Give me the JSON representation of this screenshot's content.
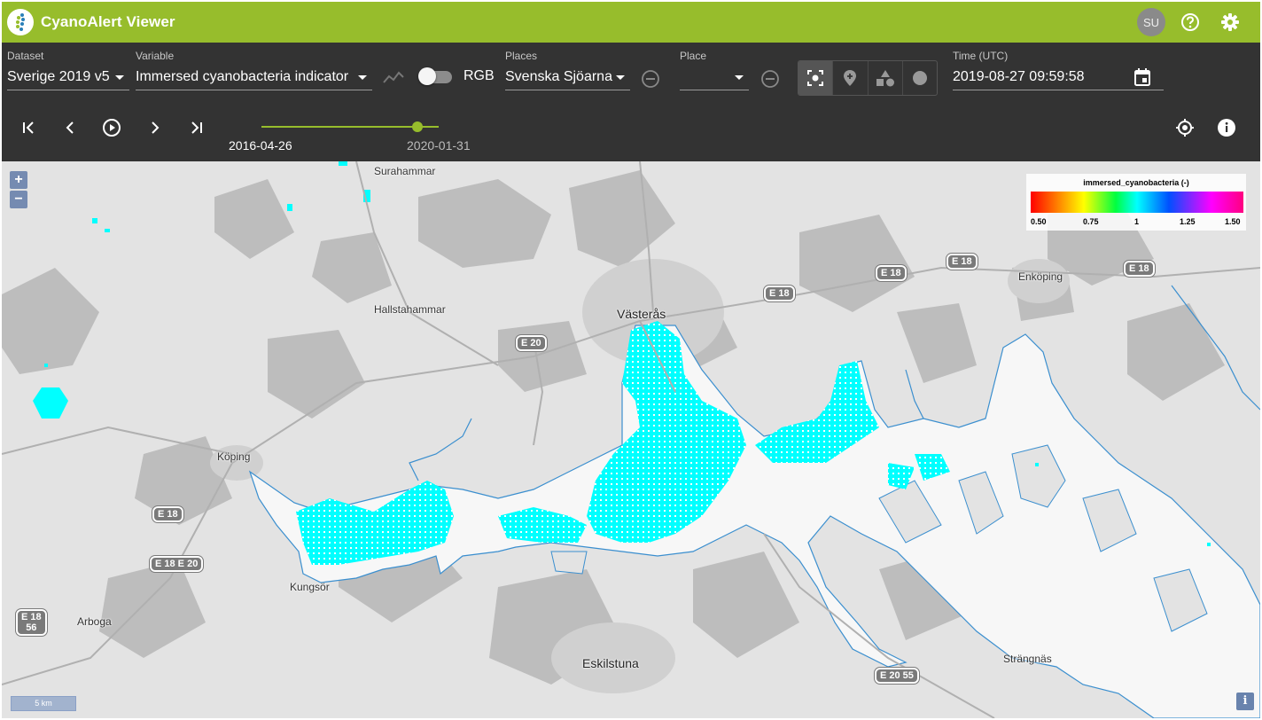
{
  "app": {
    "title": "CyanoAlert Viewer",
    "user_initials": "SU",
    "accent_color": "#97bd2c"
  },
  "controls": {
    "dataset": {
      "label": "Dataset",
      "value": "Sverige 2019 v5"
    },
    "variable": {
      "label": "Variable",
      "value": "Immersed cyanobacteria indicator"
    },
    "rgb_toggle": {
      "label": "RGB",
      "checked": false
    },
    "places": {
      "label": "Places",
      "value": "Svenska Sjöarna"
    },
    "place": {
      "label": "Place",
      "value": ""
    },
    "time": {
      "label": "Time (UTC)",
      "value": "2019-08-27 09:59:58"
    },
    "place_mode_buttons": [
      "select-icon",
      "add-point-icon",
      "add-polygon-icon",
      "add-circle-icon"
    ]
  },
  "timeline": {
    "start_label": "2016-04-26",
    "end_label": "2020-01-31",
    "position_fraction": 0.85
  },
  "map": {
    "places": [
      "Surahammar",
      "Hallstahammar",
      "Västerås",
      "Köping",
      "Kungsör",
      "Arboga",
      "Eskilstuna",
      "Enköping",
      "Strängnäs"
    ],
    "road_shields": [
      "E 18",
      "E 18",
      "E 18",
      "E 18",
      "E 18",
      "E 18\nE 20",
      "E 18\n56",
      "E 20",
      "E 20\n55"
    ],
    "zoom_in": "+",
    "zoom_out": "−",
    "scale_label": "5 km",
    "info_label": "i",
    "legend": {
      "title": "immersed_cyanobacteria (-)",
      "ticks": [
        "0.50",
        "0.75",
        "1",
        "1.25",
        "1.50"
      ]
    }
  }
}
